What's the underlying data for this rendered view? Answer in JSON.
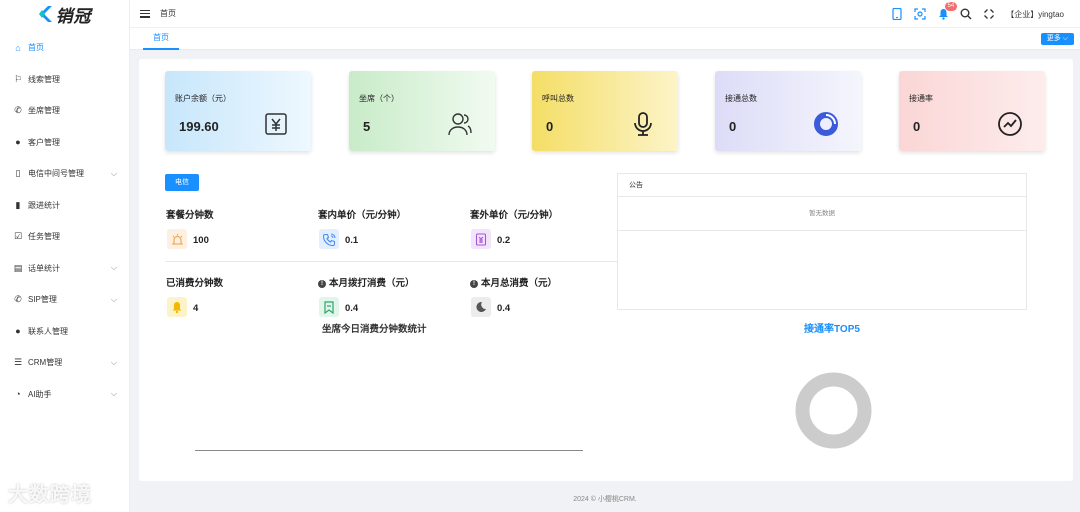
{
  "app": {
    "logo_text": "销冠"
  },
  "header": {
    "breadcrumb": "首页",
    "notification_count": "54",
    "user": "【企业】yingtao"
  },
  "tabs": {
    "active": "首页",
    "more": "更多"
  },
  "sidebar": {
    "items": [
      {
        "label": "首页",
        "icon": "home-icon",
        "glyph": "⌂",
        "chevron": false
      },
      {
        "label": "线索管理",
        "icon": "flag-icon",
        "glyph": "⚐",
        "chevron": false
      },
      {
        "label": "坐席管理",
        "icon": "phone-icon",
        "glyph": "✆",
        "chevron": false
      },
      {
        "label": "客户管理",
        "icon": "user-icon",
        "glyph": "●",
        "chevron": false
      },
      {
        "label": "电信中间号管理",
        "icon": "mobile-icon",
        "glyph": "▯",
        "chevron": true
      },
      {
        "label": "跟进统计",
        "icon": "bar-chart-icon",
        "glyph": "▮",
        "chevron": false
      },
      {
        "label": "任务管理",
        "icon": "task-icon",
        "glyph": "☑",
        "chevron": false
      },
      {
        "label": "话单统计",
        "icon": "document-icon",
        "glyph": "▤",
        "chevron": true
      },
      {
        "label": "SIP管理",
        "icon": "sip-phone-icon",
        "glyph": "✆",
        "chevron": true
      },
      {
        "label": "联系人管理",
        "icon": "contact-icon",
        "glyph": "●",
        "chevron": false
      },
      {
        "label": "CRM管理",
        "icon": "sliders-icon",
        "glyph": "☰",
        "chevron": true
      },
      {
        "label": "AI助手",
        "icon": "ai-icon",
        "glyph": "◔",
        "chevron": true
      }
    ]
  },
  "stats": [
    {
      "label": "账户余额（元）",
      "value": "199.60",
      "icon": "yuan-icon"
    },
    {
      "label": "坐席（个）",
      "value": "5",
      "icon": "people-icon"
    },
    {
      "label": "呼叫总数",
      "value": "0",
      "icon": "microphone-icon"
    },
    {
      "label": "接通总数",
      "value": "0",
      "icon": "pie-icon"
    },
    {
      "label": "接通率",
      "value": "0",
      "icon": "trend-icon"
    }
  ],
  "telecom": {
    "button": "电信",
    "metrics": [
      {
        "title": "套餐分钟数",
        "value": "100"
      },
      {
        "title": "套内单价（元/分钟）",
        "value": "0.1"
      },
      {
        "title": "套外单价（元/分钟）",
        "value": "0.2"
      },
      {
        "title": "已消费分钟数",
        "value": "4"
      },
      {
        "title": "本月拨打消费（元）",
        "value": "0.4"
      },
      {
        "title": "本月总消费（元）",
        "value": "0.4"
      }
    ],
    "chart_title": "坐席今日消费分钟数统计"
  },
  "notice": {
    "title": "公告",
    "empty": "暂无数据"
  },
  "top5": {
    "title": "接通率TOP5"
  },
  "footer": "2024 © 小樱桃CRM.",
  "watermark": "大数跨境",
  "colors": {
    "primary": "#1890ff",
    "badge": "#f56c6c"
  }
}
